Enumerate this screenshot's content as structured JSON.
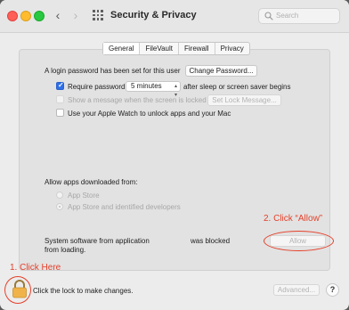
{
  "window": {
    "title": "Security & Privacy",
    "search_placeholder": "Search"
  },
  "tabs": [
    "General",
    "FileVault",
    "Firewall",
    "Privacy"
  ],
  "active_tab": "General",
  "login": {
    "message": "A login password has been set for this user",
    "change_password_label": "Change Password...",
    "require_password_label": "Require password",
    "require_password_checked": true,
    "require_password_delay": "5 minutes",
    "require_password_suffix": "after sleep or screen saver begins",
    "show_message_label": "Show a message when the screen is locked",
    "show_message_checked": false,
    "set_lock_message_label": "Set Lock Message...",
    "apple_watch_label": "Use your Apple Watch to unlock apps and your Mac",
    "apple_watch_checked": false
  },
  "downloads": {
    "heading": "Allow apps downloaded from:",
    "options": [
      "App Store",
      "App Store and identified developers"
    ],
    "selected": "App Store and identified developers"
  },
  "blocked": {
    "text_part1": "System software from application",
    "text_part2": "was blocked",
    "text_part3": "from loading.",
    "allow_label": "Allow"
  },
  "footer": {
    "lock_text": "Click the lock to make changes.",
    "advanced_label": "Advanced...",
    "help_label": "?"
  },
  "annotations": {
    "step1": "1. Click Here",
    "step2": "2. Click “Allow”"
  },
  "colors": {
    "annotation": "#e5402a",
    "checkbox_accent": "#2f6fe8",
    "lock_icon": "#f0b34a"
  }
}
